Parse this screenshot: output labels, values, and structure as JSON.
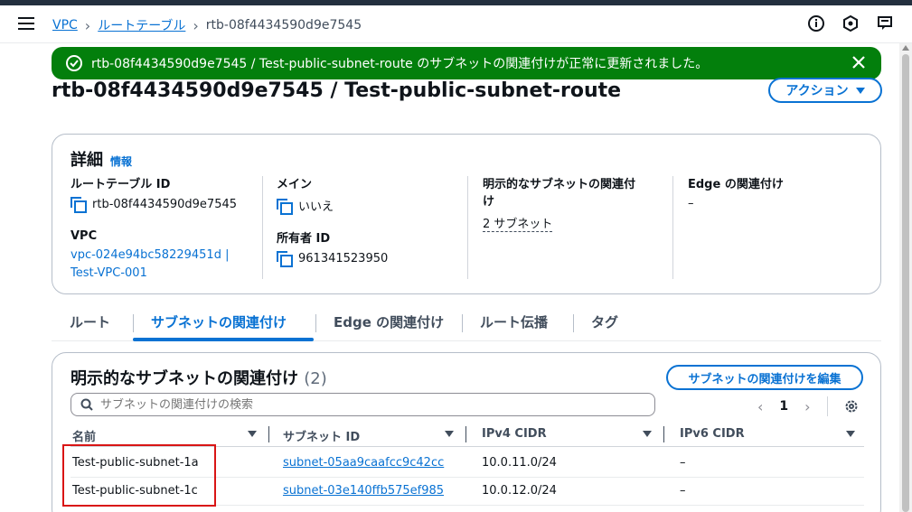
{
  "breadcrumb": {
    "items": [
      "VPC",
      "ルートテーブル"
    ],
    "current": "rtb-08f4434590d9e7545"
  },
  "flash": {
    "message": "rtb-08f4434590d9e7545 / Test-public-subnet-route のサブネットの関連付けが正常に更新されました。"
  },
  "page": {
    "title": "rtb-08f4434590d9e7545 / Test-public-subnet-route",
    "action_label": "アクション"
  },
  "details": {
    "heading": "詳細",
    "info_link": "情報",
    "route_table_id_label": "ルートテーブル ID",
    "route_table_id": "rtb-08f4434590d9e7545",
    "vpc_label": "VPC",
    "vpc_value_line1": "vpc-024e94bc58229451d |",
    "vpc_value_line2": "Test-VPC-001",
    "main_label": "メイン",
    "main_value": "いいえ",
    "owner_label": "所有者 ID",
    "owner_value": "961341523950",
    "explicit_label_line1": "明示的なサブネットの関連付",
    "explicit_label_line2": "け",
    "explicit_value": "2 サブネット",
    "edge_label": "Edge の関連付け",
    "edge_value": "–"
  },
  "tabs": [
    "ルート",
    "サブネットの関連付け",
    "Edge の関連付け",
    "ルート伝播",
    "タグ"
  ],
  "table": {
    "title": "明示的なサブネットの関連付け",
    "count": "(2)",
    "edit_label": "サブネットの関連付けを編集",
    "search_placeholder": "サブネットの関連付けの検索",
    "page_number": "1",
    "columns": [
      "名前",
      "サブネット ID",
      "IPv4 CIDR",
      "IPv6 CIDR"
    ],
    "rows": [
      {
        "name": "Test-public-subnet-1a",
        "subnet_id": "subnet-05aa9caafcc9c42cc",
        "ipv4": "10.0.11.0/24",
        "ipv6": "–"
      },
      {
        "name": "Test-public-subnet-1c",
        "subnet_id": "subnet-03e140ffb575ef985",
        "ipv4": "10.0.12.0/24",
        "ipv6": "–"
      }
    ]
  },
  "colors": {
    "link": "#0972d3",
    "success": "#037f0c",
    "highlight": "#d91515"
  }
}
